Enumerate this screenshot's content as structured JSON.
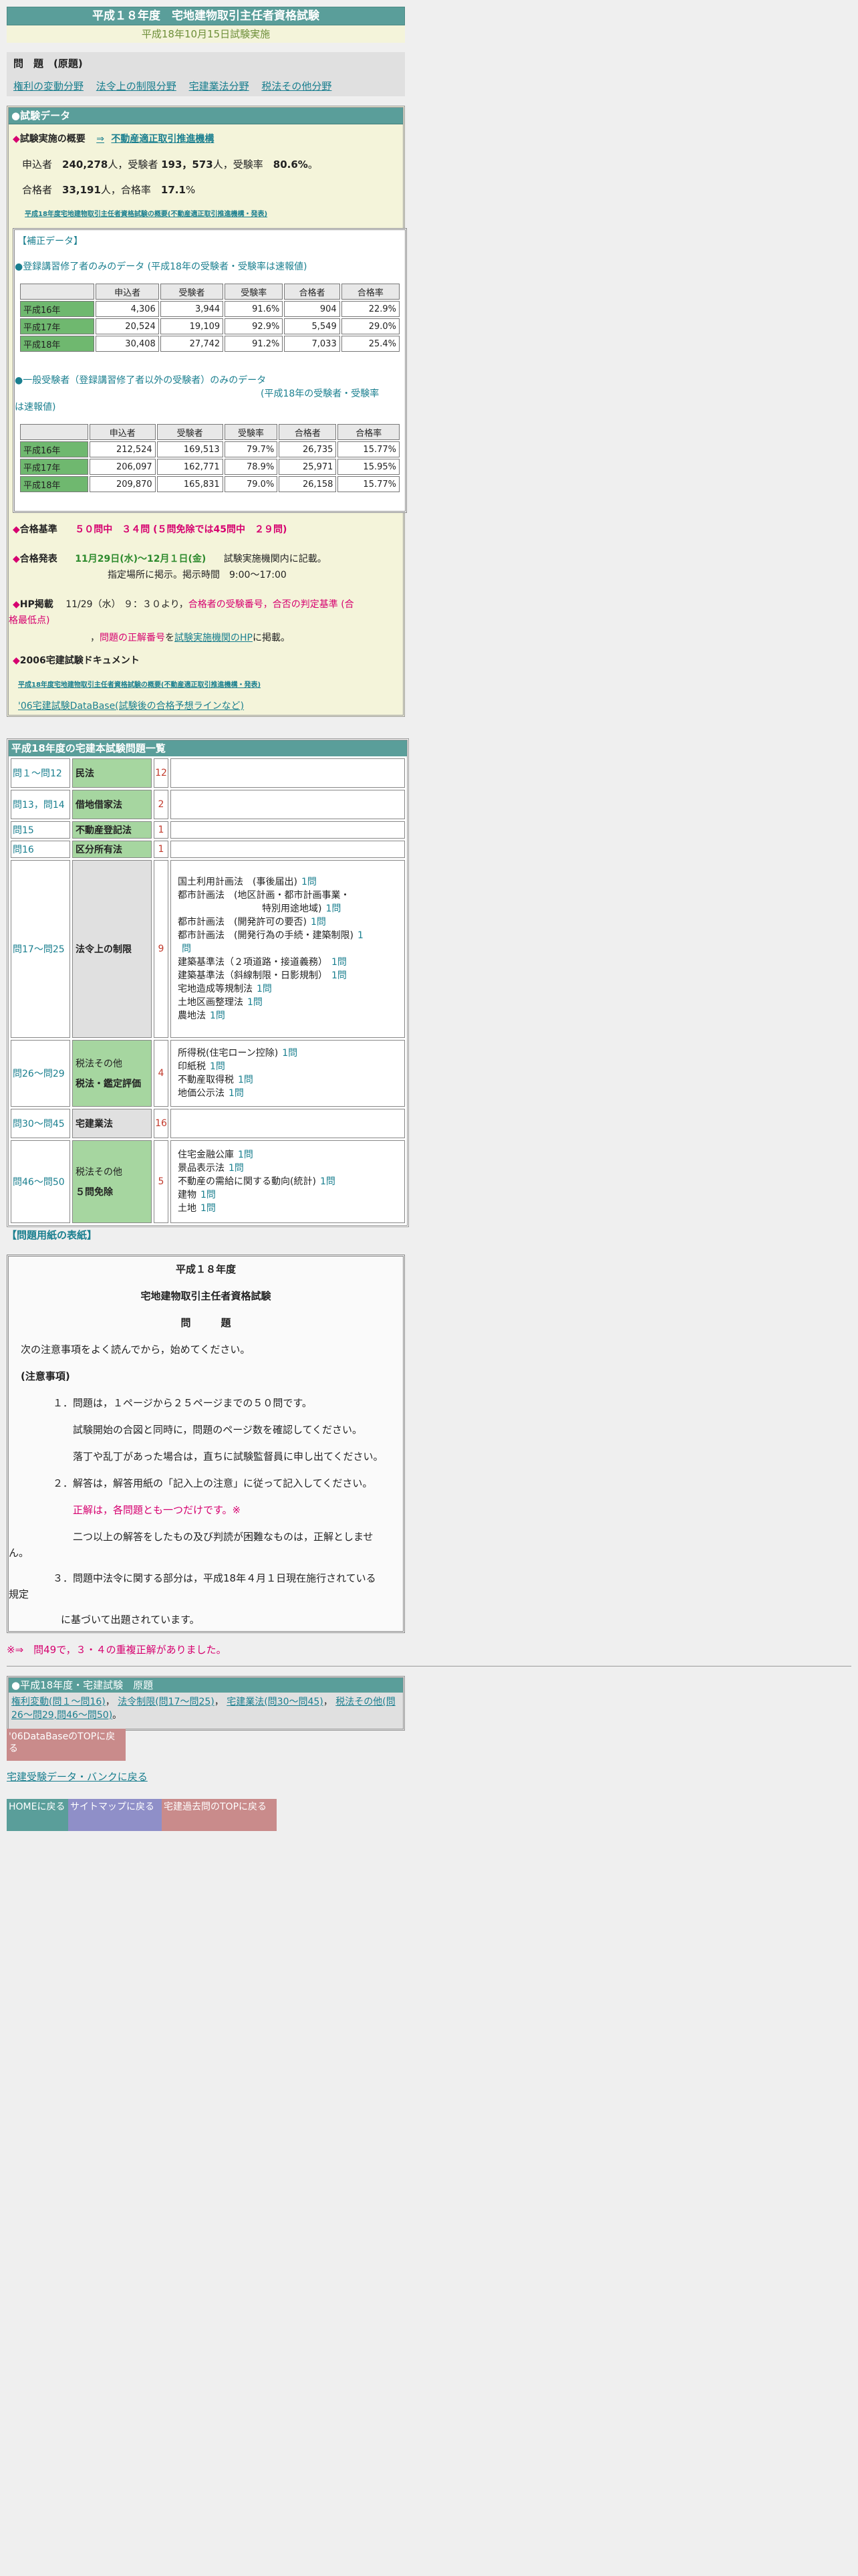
{
  "header": {
    "title": "平成１８年度　宅地建物取引主任者資格試験",
    "subtitle": "平成18年10月15日試験実施"
  },
  "problems": {
    "title": "問　題　(原題)",
    "links": [
      "権利の変動分野",
      "法令上の制限分野",
      "宅建業法分野",
      "税法その他分野"
    ]
  },
  "shiken": {
    "bar_title": "●試験データ",
    "overview_label": "試験実施の概要",
    "overview_arrow": "⇒",
    "overview_link": "不動産適正取引推進機構",
    "stats_line1_a": "申込者　",
    "applicants": "240,278",
    "stats_line1_b": "人，受験者 ",
    "examinees": "193，573",
    "stats_line1_c": "人，受験率　",
    "exam_rate": "80.6%",
    "stats_line1_d": "。",
    "stats_line2_a": "合格者　",
    "passers": "33,191",
    "stats_line2_b": "人，合格率　",
    "pass_rate": "17.1",
    "stats_line2_c": "%",
    "summary_link": "平成18年度宅地建物取引主任者資格試験の概要(不動産適正取引推進機構・発表)",
    "hosei_title": "【補正データ】",
    "registered_title": "●登録講習修了者のみのデータ (平成18年の受験者・受験率は速報値)",
    "table_headers": [
      "",
      "申込者",
      "受験者",
      "受験率",
      "合格者",
      "合格率"
    ],
    "registered_rows": [
      [
        "平成16年",
        "4,306",
        "3,944",
        "91.6%",
        "904",
        "22.9%"
      ],
      [
        "平成17年",
        "20,524",
        "19,109",
        "92.9%",
        "5,549",
        "29.0%"
      ],
      [
        "平成18年",
        "30,408",
        "27,742",
        "91.2%",
        "7,033",
        "25.4%"
      ]
    ],
    "general_title": "●一般受験者（登録講習修了者以外の受験者）のみのデータ",
    "general_note_a": "(平成18年の受験者・受験率",
    "general_note_b": "は速報値)",
    "general_rows": [
      [
        "平成16年",
        "212,524",
        "169,513",
        "79.7%",
        "26,735",
        "15.77%"
      ],
      [
        "平成17年",
        "206,097",
        "162,771",
        "78.9%",
        "25,971",
        "15.95%"
      ],
      [
        "平成18年",
        "209,870",
        "165,831",
        "79.0%",
        "26,158",
        "15.77%"
      ]
    ],
    "criteria_label": "合格基準",
    "criteria_value": "５０問中　３４問 (５問免除では45問中　２９問)",
    "announce_label": "合格発表",
    "announce_date": "11月29日(水)～12月１日(金)",
    "announce_text1": "試験実施機関内に記載。",
    "announce_text2": "指定場所に掲示。掲示時間　9:00～17:00",
    "hp_label": "HP掲載",
    "hp_text1": "11/29（水） ９：３０より，",
    "hp_text2": "合格者の受験番号",
    "hp_text3": "，合否の判定基準 (合",
    "hp_text4": "格最低点)",
    "hp_text5": "，",
    "hp_text6": "問題の正解番号",
    "hp_text7": "を",
    "hp_link": "試験実施機関のHP",
    "hp_text8": "に掲載。",
    "doc_label": "2006宅建試験ドキュメント",
    "doc_link1": "平成18年度宅地建物取引主任者資格試験の概要(不動産適正取引推進機構・発表)",
    "doc_link2": "'06宅建試験DataBase(試験後の合格予想ラインなど)"
  },
  "grid": {
    "title": "平成18年度の宅建本試験問題一覧",
    "rows": [
      {
        "num": "問１～問12",
        "cat": "民法",
        "cnt": "12",
        "det": []
      },
      {
        "num": "問13，問14",
        "cat": "借地借家法",
        "cnt": "2",
        "det": []
      },
      {
        "num": "問15",
        "cat": "不動産登記法",
        "cnt": "1",
        "det": []
      },
      {
        "num": "問16",
        "cat": "区分所有法",
        "cnt": "1",
        "det": []
      },
      {
        "num": "問17～問25",
        "cat": "法令上の制限",
        "cnt": "9",
        "det": [
          [
            "国土利用計画法　(事後届出)",
            "1問"
          ],
          [
            "都市計画法　(地区計画・都市計画事業・",
            ""
          ],
          [
            "　　　　　　　　　特別用途地域)",
            "1問"
          ],
          [
            "都市計画法　(開発許可の要否)",
            "1問"
          ],
          [
            "都市計画法　(開発行為の手続・建築制限)",
            "1"
          ],
          [
            "",
            "問"
          ],
          [
            "建築基準法（２項道路・接道義務）",
            "1問"
          ],
          [
            "建築基準法（斜線制限・日影規制）",
            "1問"
          ],
          [
            "宅地造成等規制法",
            "1問"
          ],
          [
            "土地区画整理法",
            "1問"
          ],
          [
            "農地法",
            "1問"
          ]
        ]
      },
      {
        "num": "問26～問29",
        "cat": "税法その他",
        "cat2": "税法・鑑定評価",
        "cnt": "4",
        "det": [
          [
            "所得税(住宅ローン控除)",
            "1問"
          ],
          [
            "印紙税",
            "1問"
          ],
          [
            "不動産取得税",
            "1問"
          ],
          [
            "地価公示法",
            "1問"
          ]
        ]
      },
      {
        "num": "問30～問45",
        "cat": "宅建業法",
        "cnt": "16",
        "det": []
      },
      {
        "num": "問46～問50",
        "cat": "税法その他",
        "cat2": "５問免除",
        "cnt": "5",
        "det": [
          [
            "住宅金融公庫",
            "1問"
          ],
          [
            "景品表示法",
            "1問"
          ],
          [
            "不動産の需給に関する動向(統計)",
            "1問"
          ],
          [
            "建物",
            "1問"
          ],
          [
            "土地",
            "1問"
          ]
        ]
      }
    ]
  },
  "cover": {
    "label": "【問題用紙の表紙】",
    "title1": "平成１８年度",
    "title2": "宅地建物取引主任者資格試験",
    "title3": "問　　　題",
    "intro": "次の注意事項をよく読んでから，始めてください。",
    "notes_title": "(注意事項)",
    "n1": "１．問題は，１ページから２５ページまでの５０問です。",
    "n1b": "試験開始の合図と同時に，問題のページ数を確認してください。",
    "n1c": "落丁や乱丁があった場合は，直ちに試験監督員に申し出てください。",
    "n2": "２．解答は，解答用紙の「記入上の注意」に従って記入してください。",
    "n2b": "正解は，各問題とも一つだけです。※",
    "n2c": "二つ以上の解答をしたもの及び判読が困難なものは，正解としませ",
    "n2d": "ん。",
    "n3": "３．問題中法令に関する部分は，平成18年４月１日現在施行されている",
    "n3b": "規定",
    "n3c": "に基づいて出題されています。"
  },
  "note49": "※⇒　問49で，３・４の重複正解がありました。",
  "kako": {
    "title": "●平成18年度・宅建試験　原題",
    "links": [
      "権利変動(問１～問16)",
      "法令制限(問17～問25)",
      "宅建業法(問30～問45)",
      "税法その他(問26～問29,問46～問50)"
    ]
  },
  "buttons": {
    "dbtop": "'06DataBaseのTOPに戻る",
    "databank": "宅建受験データ・バンクに戻る",
    "home": "HOMEに戻る",
    "sitemap": "サイトマップに戻る",
    "kakotop": "宅建過去問のTOPに戻る"
  },
  "colors": {
    "teal": "#5a9e9a",
    "cream": "#f4f4da",
    "green": "#6fb86f",
    "magenta": "#d6006f",
    "btn_home": "#5a9e9a",
    "btn_sitemap": "#8f8fc8",
    "btn_kako": "#c98b8b"
  }
}
